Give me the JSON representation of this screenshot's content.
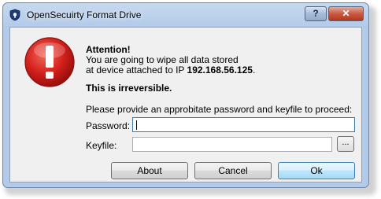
{
  "window": {
    "title": "OpenSecuirty Format Drive",
    "help_label": "?",
    "close_label": "✕"
  },
  "message": {
    "heading": "Attention!",
    "line1": "You are going to wipe all data stored",
    "line2_prefix": "at device attached to IP ",
    "ip": "192.168.56.125",
    "line2_suffix": ".",
    "warning": "This is irreversible.",
    "prompt": "Please provide an approbitate password and keyfile to proceed:"
  },
  "form": {
    "password_label": "Password:",
    "password_value": "",
    "keyfile_label": "Keyfile:",
    "keyfile_value": "",
    "browse_label": "..."
  },
  "buttons": {
    "about": "About",
    "cancel": "Cancel",
    "ok": "Ok"
  },
  "icons": {
    "title": "shield-icon",
    "warning": "error-exclamation-icon"
  },
  "colors": {
    "warning_red": "#d3201b",
    "titlebar": "#b3cbe8",
    "close_button": "#c75b43"
  }
}
